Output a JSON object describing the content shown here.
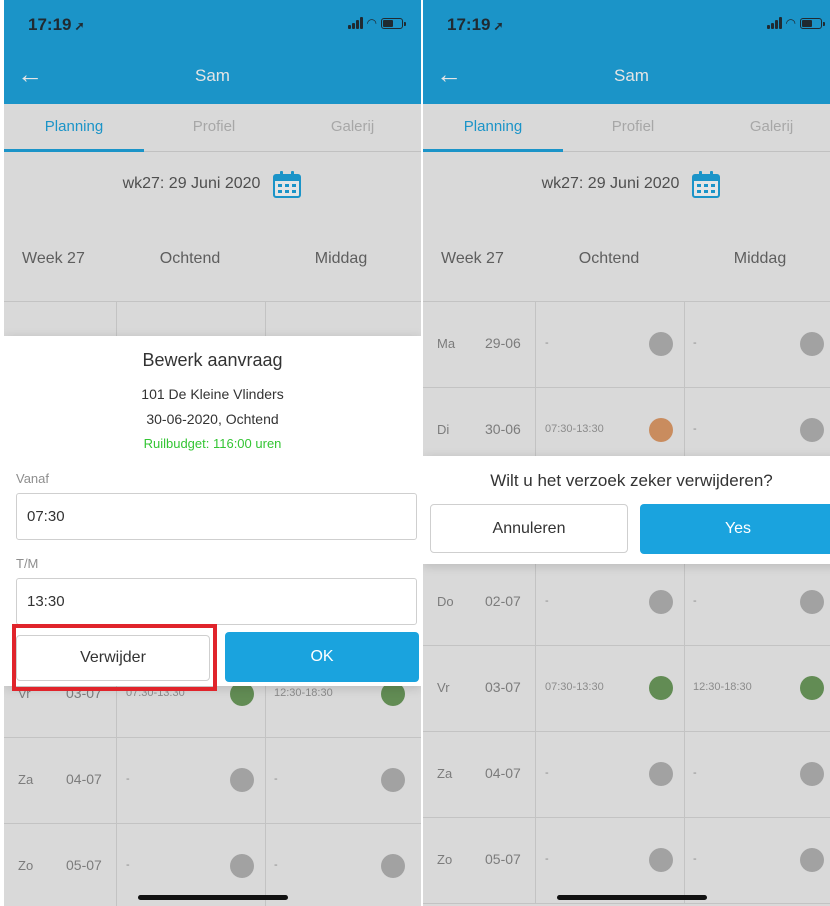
{
  "colors": {
    "primary": "#1aa3de",
    "budget_text": "#34c534",
    "highlight": "#e0242b",
    "status_green": "#6a9a5a",
    "status_orange": "#e09a66",
    "status_grey": "#b3b3b3"
  },
  "left": {
    "status_time": "17:19",
    "title": "Sam",
    "tabs": [
      {
        "label": "Planning"
      },
      {
        "label": "Profiel"
      },
      {
        "label": "Galerij"
      }
    ],
    "week_label": "wk27: 29 Juni 2020",
    "grid_header": {
      "week": "Week 27",
      "morning": "Ochtend",
      "afternoon": "Middag"
    },
    "rows": [
      {
        "day": "Vr",
        "date": "03-07",
        "morning": "07:30-13:30",
        "afternoon": "12:30-18:30"
      },
      {
        "day": "Za",
        "date": "04-07",
        "morning": "-",
        "afternoon": "-"
      },
      {
        "day": "Zo",
        "date": "05-07",
        "morning": "-",
        "afternoon": "-"
      }
    ],
    "dialog": {
      "title": "Bewerk aanvraag",
      "location": "101 De Kleine Vlinders",
      "slot": "30-06-2020, Ochtend",
      "budget": "Ruilbudget: 116:00 uren",
      "from_label": "Vanaf",
      "from_value": "07:30",
      "to_label": "T/M",
      "to_value": "13:30",
      "delete_label": "Verwijder",
      "ok_label": "OK"
    }
  },
  "right": {
    "status_time": "17:19",
    "title": "Sam",
    "tabs": [
      {
        "label": "Planning"
      },
      {
        "label": "Profiel"
      },
      {
        "label": "Galerij"
      }
    ],
    "week_label": "wk27: 29 Juni 2020",
    "grid_header": {
      "week": "Week 27",
      "morning": "Ochtend",
      "afternoon": "Middag"
    },
    "rows": [
      {
        "day": "Ma",
        "date": "29-06",
        "morning": "-",
        "afternoon": "-"
      },
      {
        "day": "Di",
        "date": "30-06",
        "morning": "07:30-13:30",
        "afternoon": "-"
      },
      {
        "day": "Do",
        "date": "02-07",
        "morning": "-",
        "afternoon": "-"
      },
      {
        "day": "Vr",
        "date": "03-07",
        "morning": "07:30-13:30",
        "afternoon": "12:30-18:30"
      },
      {
        "day": "Za",
        "date": "04-07",
        "morning": "-",
        "afternoon": "-"
      },
      {
        "day": "Zo",
        "date": "05-07",
        "morning": "-",
        "afternoon": "-"
      }
    ],
    "dialog": {
      "message": "Wilt u het verzoek zeker verwijderen?",
      "cancel_label": "Annuleren",
      "yes_label": "Yes"
    }
  }
}
